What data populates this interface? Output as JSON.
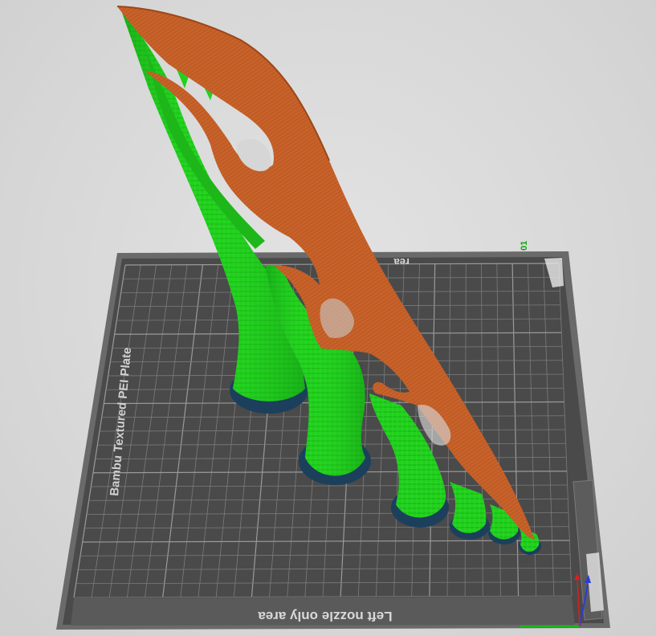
{
  "plate": {
    "name_label": "Bambu Textured PEI Plate",
    "bottom_label": "Left nozzle only area",
    "top_label": "Right nozzle only area",
    "top_label_visible_fragment": "rea",
    "plate_number": "01"
  },
  "colors": {
    "background": "#d9d9d9",
    "plate": "#4a4a4a",
    "plate_edge": "#6e6e6e",
    "grid": "#8a8a8a",
    "support": "#22d11e",
    "support_dark": "#109a10",
    "model": "#c8622a",
    "model_dark": "#9c4718",
    "brim": "#1c3f5c",
    "axis_x": "#16b816",
    "axis_y": "#2c3cd6",
    "axis_z": "#d82020",
    "plate_number_color": "#11a011"
  },
  "axes": [
    "x-axis",
    "y-axis",
    "z-axis"
  ]
}
